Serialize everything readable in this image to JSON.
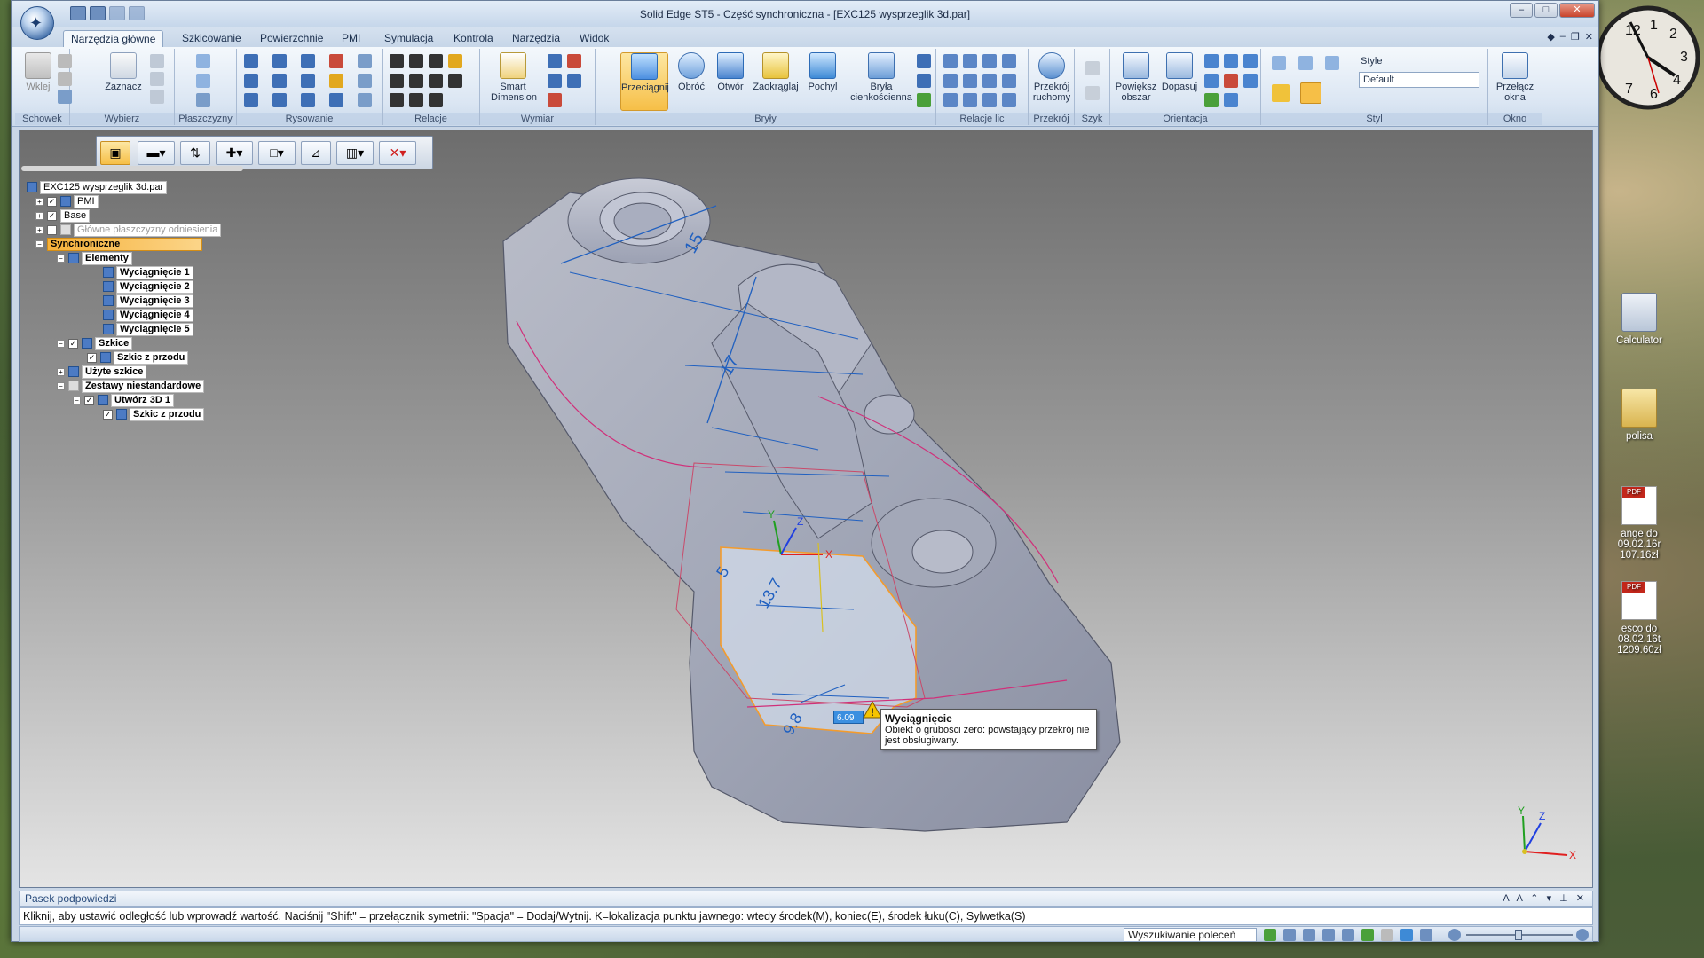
{
  "window": {
    "title": "Solid Edge ST5 - Część synchroniczna - [EXC125 wysprzeglik 3d.par]"
  },
  "ribbon": {
    "tabs": [
      "Narzędzia główne",
      "Szkicowanie",
      "Powierzchnie",
      "PMI",
      "Symulacja",
      "Kontrola",
      "Narzędzia",
      "Widok"
    ],
    "groups": {
      "schowek": "Schowek",
      "wybierz": "Wybierz",
      "plaszczyzny": "Płaszczyzny",
      "rysowanie": "Rysowanie",
      "relacje": "Relacje",
      "wymiar": "Wymiar",
      "bryly": "Bryły",
      "relacje_lic": "Relacje lic",
      "przekroj": "Przekrój",
      "szyk": "Szyk",
      "orientacja": "Orientacja",
      "styl": "Styl",
      "okno": "Okno"
    },
    "buttons": {
      "wklej": "Wklej",
      "zaznacz": "Zaznacz",
      "smart_dimension_1": "Smart",
      "smart_dimension_2": "Dimension",
      "przeciagnij": "Przeciągnij",
      "obroc": "Obróć",
      "otwor": "Otwór",
      "zaokraglaj": "Zaokrąglaj",
      "pochyl": "Pochyl",
      "bryla_1": "Bryła",
      "bryla_2": "cienkościenna",
      "przekroj_1": "Przekrój",
      "przekroj_2": "ruchomy",
      "powieksz_1": "Powiększ",
      "powieksz_2": "obszar",
      "dopasuj": "Dopasuj",
      "przelacz_1": "Przełącz",
      "przelacz_2": "okna"
    },
    "style": {
      "label": "Style",
      "value": "Default"
    }
  },
  "tree": {
    "root": "EXC125 wysprzeglik 3d.par",
    "nodes": {
      "pmi": "PMI",
      "base": "Base",
      "planes": "Główne płaszczyzny odniesienia",
      "sync": "Synchroniczne",
      "elementy": "Elementy",
      "w1": "Wyciągnięcie 1",
      "w2": "Wyciągnięcie 2",
      "w3": "Wyciągnięcie 3",
      "w4": "Wyciągnięcie 4",
      "w5": "Wyciągnięcie 5",
      "szkice": "Szkice",
      "szkic_przod": "Szkic z przodu",
      "uzyte": "Użyte szkice",
      "zestawy": "Zestawy niestandardowe",
      "utworz": "Utwórz 3D 1",
      "szkic_przod2": "Szkic z przodu"
    }
  },
  "model": {
    "dims": [
      "15",
      "17",
      "5",
      "13.7",
      "9.8"
    ],
    "value_input": "6.09",
    "triad": {
      "x": "X",
      "y": "Y",
      "z": "Z"
    }
  },
  "tooltip": {
    "title": "Wyciągnięcie",
    "text": "Obiekt o grubości zero: powstający przekrój nie jest obsługiwany."
  },
  "prompt": {
    "header": "Pasek podpowiedzi",
    "text": "Kliknij, aby ustawić odległość lub wprowadź wartość.  Naciśnij \"Shift\" = przełącznik symetrii: \"Spacja\" = Dodaj/Wytnij. K=lokalizacja punktu jawnego: wtedy środek(M), koniec(E), środek łuku(C), Sylwetka(S)"
  },
  "statusbar": {
    "search": "Wyszukiwanie poleceń"
  },
  "desktop": {
    "icons": [
      {
        "label": "Calculator"
      },
      {
        "label": "polisa"
      },
      {
        "label_1": "ange do 09.02.16r",
        "label_2": "107.16zł"
      },
      {
        "label_1": "esco do 08.02.16t",
        "label_2": "1209.60zł"
      }
    ]
  },
  "colors": {
    "accent": "#f6bf47",
    "ribbon": "#dbe6f3",
    "dimension": "#2060c0",
    "warning": "#f5c400"
  }
}
